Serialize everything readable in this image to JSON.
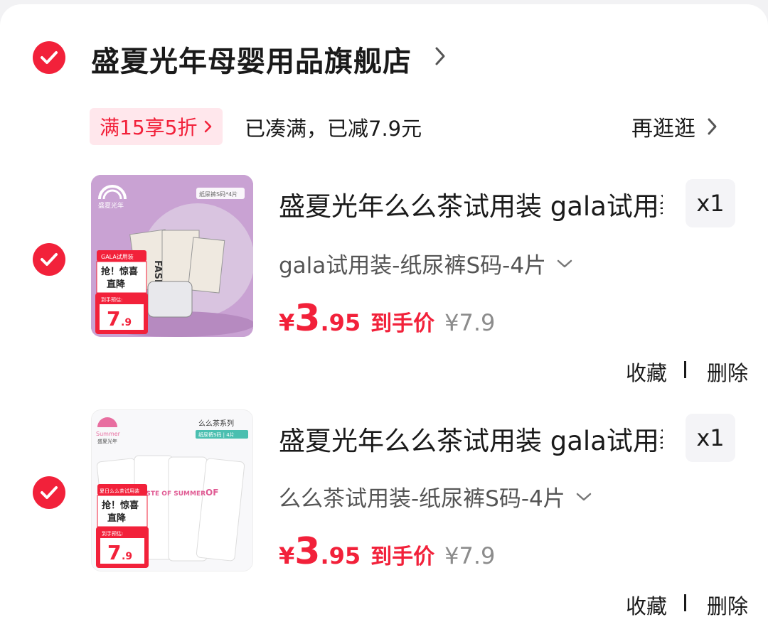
{
  "store": {
    "name": "盛夏光年母婴用品旗舰店",
    "promo_badge": "满15享5折",
    "promo_status": "已凑满，已减7.9元",
    "more_link": "再逛逛"
  },
  "items": [
    {
      "title": "盛夏光年么么茶试用装 gala试用装",
      "sku": "gala试用装-纸尿裤S码-4片",
      "price_symbol": "¥",
      "price_int": "3",
      "price_dec": ".95",
      "price_label": "到手价",
      "original_price": "¥7.9",
      "quantity": "x1",
      "favorite": "收藏",
      "delete": "删除",
      "thumb": {
        "brand": "盛夏光年",
        "pack_tag": "纸尿裤S码*4片",
        "series_tag": "",
        "promo_tag": "GALA试用装",
        "headline_1": "抢！惊喜",
        "headline_2": "直降",
        "price_tag": "到手预估:",
        "price_int": "7",
        "price_dec": ".9",
        "pack_text": "FASHION",
        "bg": "#c49ccf"
      }
    },
    {
      "title": "盛夏光年么么茶试用装 gala试用装",
      "sku": "么么茶试用装-纸尿裤S码-4片",
      "price_symbol": "¥",
      "price_int": "3",
      "price_dec": ".95",
      "price_label": "到手价",
      "original_price": "¥7.9",
      "quantity": "x1",
      "favorite": "收藏",
      "delete": "删除",
      "thumb": {
        "brand": "盛夏光年",
        "pack_tag": "纸尿裤S码 | 4片",
        "series_tag": "么么茶系列",
        "promo_tag": "夏日么么茶试用装",
        "headline_1": "抢！惊喜",
        "headline_2": "直降",
        "price_tag": "到手预估:",
        "price_int": "7",
        "price_dec": ".9",
        "pack_text": "TASTE OF SUMMER",
        "bg": "#f7f7f9"
      }
    }
  ],
  "colors": {
    "accent": "#f2213a",
    "badge_bg": "#ffe7ec",
    "muted": "#8c8c8c"
  }
}
